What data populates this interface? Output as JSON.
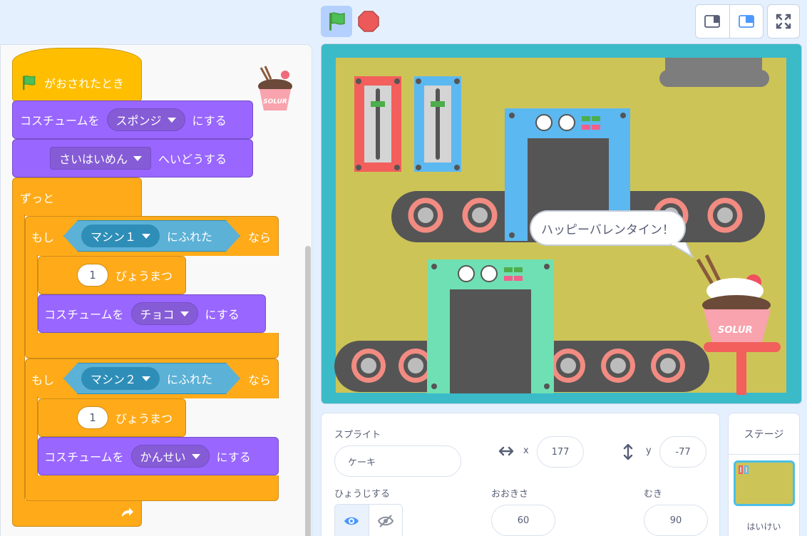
{
  "toolbar": {
    "green_flag_icon": "green-flag-icon",
    "stop_icon": "stop-icon",
    "layout_small_icon": "small-stage-icon",
    "layout_normal_icon": "normal-stage-icon",
    "fullscreen_icon": "fullscreen-icon"
  },
  "script": {
    "hat_label": "がおされたとき",
    "costume_to": "コスチュームを",
    "costume_sponge": "スポンジ",
    "costume_suffix": "にする",
    "backdrop_select": "さいはいめん",
    "backdrop_suffix": "へいどうする",
    "forever_label": "ずっと",
    "if1_label": "もし",
    "if1_sensing": "マシン１",
    "if1_touching": "にふれた",
    "if1_then": "なら",
    "wait1_value": "1",
    "wait1_label": "びょうまつ",
    "costume2_to": "コスチュームを",
    "costume_choco": "チョコ",
    "costume2_suffix": "にする",
    "if2_label": "もし",
    "if2_sensing": "マシン２",
    "if2_touching": "にふれた",
    "if2_then": "なら",
    "wait2_value": "1",
    "wait2_label": "びょうまつ",
    "costume3_to": "コスチュームを",
    "costume_done": "かんせい",
    "costume3_suffix": "にする"
  },
  "stage": {
    "speech": "ハッピーバレンタイン！",
    "cake_label": "SOLUR"
  },
  "sprite_info": {
    "sprite_label": "スプライト",
    "sprite_name": "ケーキ",
    "x_label": "x",
    "x_value": "177",
    "y_label": "y",
    "y_value": "-77",
    "show_label": "ひょうじする",
    "size_label": "おおきさ",
    "size_value": "60",
    "direction_label": "むき",
    "direction_value": "90"
  },
  "stage_panel": {
    "title": "ステージ",
    "backdrops_label": "はいけい"
  },
  "colors": {
    "events": "#ffbf00",
    "looks": "#9966ff",
    "control": "#ffab19",
    "sensing": "#5cb1d6",
    "stage_bg": "#cdc458",
    "stage_border": "#3bbac8"
  }
}
